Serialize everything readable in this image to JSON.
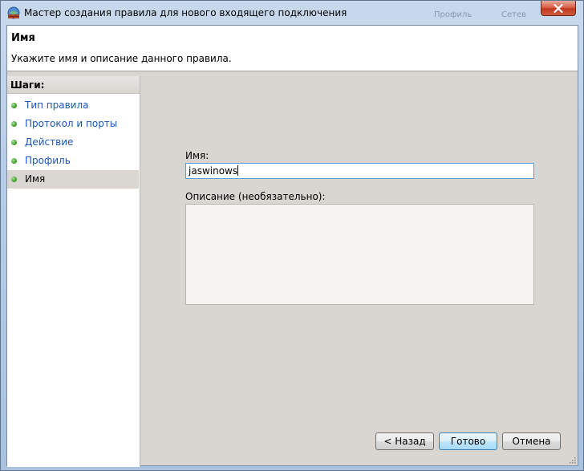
{
  "window": {
    "title": "Мастер создания правила для нового входящего подключения",
    "ghost_right_1": "Профиль",
    "ghost_right_2": "Сетев"
  },
  "header": {
    "title": "Имя",
    "description": "Укажите имя и описание данного правила."
  },
  "sidebar": {
    "title": "Шаги:",
    "items": [
      {
        "label": "Тип правила"
      },
      {
        "label": "Протокол и порты"
      },
      {
        "label": "Действие"
      },
      {
        "label": "Профиль"
      },
      {
        "label": "Имя"
      }
    ]
  },
  "form": {
    "name_label": "Имя:",
    "name_value": "jaswinows",
    "description_label": "Описание (необязательно):",
    "description_value": ""
  },
  "buttons": {
    "back": "< Назад",
    "finish": "Готово",
    "cancel": "Отмена"
  },
  "colors": {
    "step_link": "#1a56b8",
    "step_dot": "#3fa12b",
    "close_button": "#c0381f"
  }
}
